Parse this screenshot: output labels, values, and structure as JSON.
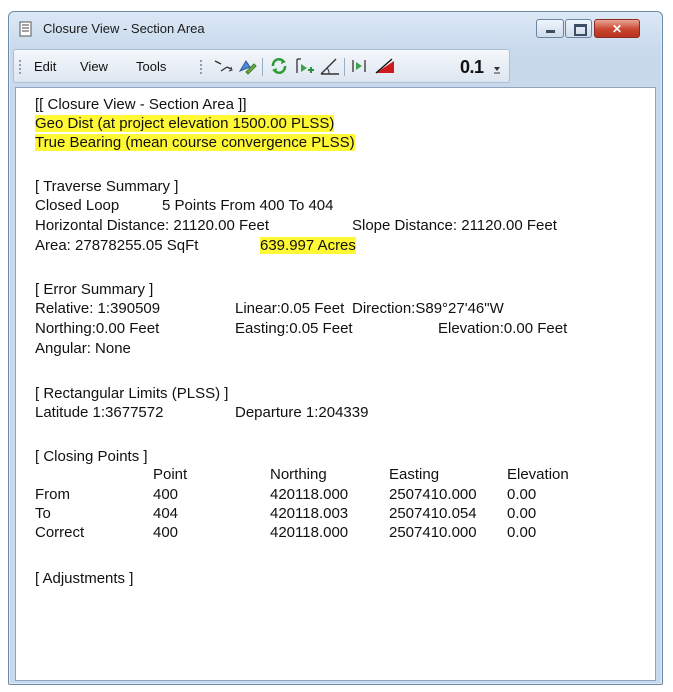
{
  "window": {
    "title": "Closure View - Section Area",
    "buttons": {
      "minimize": "",
      "maximize": "",
      "close": "✕"
    }
  },
  "menu": {
    "edit": "Edit",
    "view": "View",
    "tools": "Tools"
  },
  "toolbar": {
    "value_label": "0.1"
  },
  "report": {
    "header": "[[ Closure View - Section Area ]]",
    "geo_dist": "Geo Dist (at project elevation 1500.00 PLSS)",
    "true_bearing": "True Bearing (mean course convergence PLSS)",
    "traverse": {
      "title": "[ Traverse Summary ]",
      "closed_loop_label": "Closed Loop",
      "points_text": "5 Points From 400 To 404",
      "horizontal": "Horizontal Distance: 21120.00 Feet",
      "slope": "Slope Distance: 21120.00 Feet",
      "area": "Area: 27878255.05 SqFt",
      "acres": "639.997 Acres"
    },
    "error": {
      "title": "[ Error Summary ]",
      "relative": "Relative: 1:390509",
      "linear": "Linear:0.05 Feet",
      "direction": "Direction:S89°27'46\"W",
      "northing": "Northing:0.00 Feet",
      "easting": "Easting:0.05 Feet",
      "elevation": "Elevation:0.00 Feet",
      "angular": "Angular: None"
    },
    "limits": {
      "title": "[ Rectangular Limits (PLSS) ]",
      "latitude": "Latitude 1:3677572",
      "departure": "Departure 1:204339"
    },
    "closing": {
      "title": "[ Closing Points ]",
      "headers": [
        "Point",
        "Northing",
        "Easting",
        "Elevation"
      ],
      "rows": [
        {
          "label": "From",
          "point": "400",
          "northing": "420118.000",
          "easting": "2507410.000",
          "elevation": "0.00"
        },
        {
          "label": "To",
          "point": "404",
          "northing": "420118.003",
          "easting": "2507410.054",
          "elevation": "0.00"
        },
        {
          "label": "Correct",
          "point": "400",
          "northing": "420118.000",
          "easting": "2507410.000",
          "elevation": "0.00"
        }
      ]
    },
    "adjustments": {
      "title": "[ Adjustments ]"
    }
  },
  "colors": {
    "highlight": "#fff835",
    "close_button": "#c9462f"
  }
}
